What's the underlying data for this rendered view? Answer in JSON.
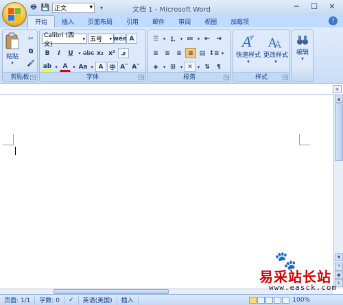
{
  "window": {
    "title": "文档 1 - Microsoft Word",
    "minimize": "─",
    "maximize": "☐",
    "close": "✕"
  },
  "qat": {
    "style_value": "正文"
  },
  "tabs": [
    {
      "label": "开始",
      "active": true
    },
    {
      "label": "插入"
    },
    {
      "label": "页面布局"
    },
    {
      "label": "引用"
    },
    {
      "label": "邮件"
    },
    {
      "label": "审阅"
    },
    {
      "label": "视图"
    },
    {
      "label": "加载项"
    }
  ],
  "ribbon": {
    "clipboard": {
      "label": "剪贴板",
      "paste_label": "粘贴"
    },
    "font": {
      "label": "字体",
      "font_name": "Calibri (西文)",
      "font_size": "五号"
    },
    "paragraph": {
      "label": "段落"
    },
    "styles": {
      "label": "样式",
      "quick_styles": "快速样式",
      "change_styles": "更改样式"
    },
    "editing": {
      "label": "编辑"
    }
  },
  "status": {
    "page": "页面: 1/1",
    "words": "字数: 0",
    "language": "英语(美国)",
    "mode": "插入",
    "zoom": "100%"
  },
  "watermark": {
    "text": "易采站长站",
    "url": "www.easck.com"
  },
  "colors": {
    "ribbon_bg": "#c9ddf6",
    "tab_bar": "#bfdbff",
    "font_color_underline": "#e00000",
    "highlight_underline": "#ffff00",
    "watermark_red": "#cc0000"
  }
}
